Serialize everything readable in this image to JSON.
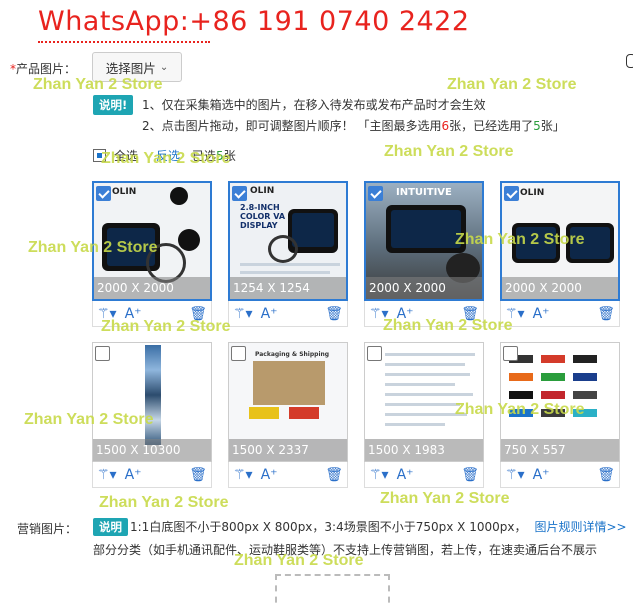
{
  "banner": {
    "text": "WhatsApp:+86 191 0740 2422"
  },
  "product_images": {
    "label": "产品图片：",
    "required_mark": "*",
    "select_button": "选择图片",
    "note_badge": "说明!",
    "note_line1": "1、仅在采集箱选中的图片，在移入待发布或发布产品时才会生效",
    "note_line2_prefix": "2、点击图片拖动，即可调整图片顺序！ 「主图最多选用",
    "note_line2_max": "6",
    "note_line2_mid": "张，已经选用了",
    "note_line2_count": "5",
    "note_line2_suffix": "张」",
    "select_all": "全选",
    "invert": "反选",
    "selected_prefix": "已选",
    "selected_count": "5",
    "selected_suffix": "张"
  },
  "images": [
    {
      "dimensions": "2000 X 2000",
      "selected": true,
      "brand": "OLIN"
    },
    {
      "dimensions": "1254 X 1254",
      "selected": true,
      "brand": "OLIN",
      "caption": "2.8-INCH COLOR VA DISPLAY"
    },
    {
      "dimensions": "2000 X 2000",
      "selected": true,
      "caption": "INTUITIVE"
    },
    {
      "dimensions": "2000 X 2000",
      "selected": true,
      "brand": "OLIN"
    },
    {
      "dimensions": "1500 X 10300",
      "selected": false
    },
    {
      "dimensions": "1500 X 2337",
      "selected": false,
      "caption": "Packaging & Shipping"
    },
    {
      "dimensions": "1500 X 1983",
      "selected": false
    },
    {
      "dimensions": "750 X 557",
      "selected": false
    }
  ],
  "tool_icons": {
    "wand": "magic-wand-icon",
    "ai": "ai-text-icon",
    "delete": "trash-icon"
  },
  "marketing": {
    "label": "营销图片：",
    "badge": "说明",
    "text": "1:1白底图不小于800px X 800px，3:4场景图不小于750px X 1000px，",
    "link": "图片规则详情>>",
    "line2": "部分分类（如手机通讯配件、运动鞋服类等）不支持上传营销图，若上传，在速卖通后台不展示"
  },
  "watermark": "Zhan Yan 2 Store",
  "colors": {
    "accent": "#1a73c9",
    "badge": "#1ea5b3",
    "red": "#e8231e",
    "green": "#2a9d3c"
  }
}
